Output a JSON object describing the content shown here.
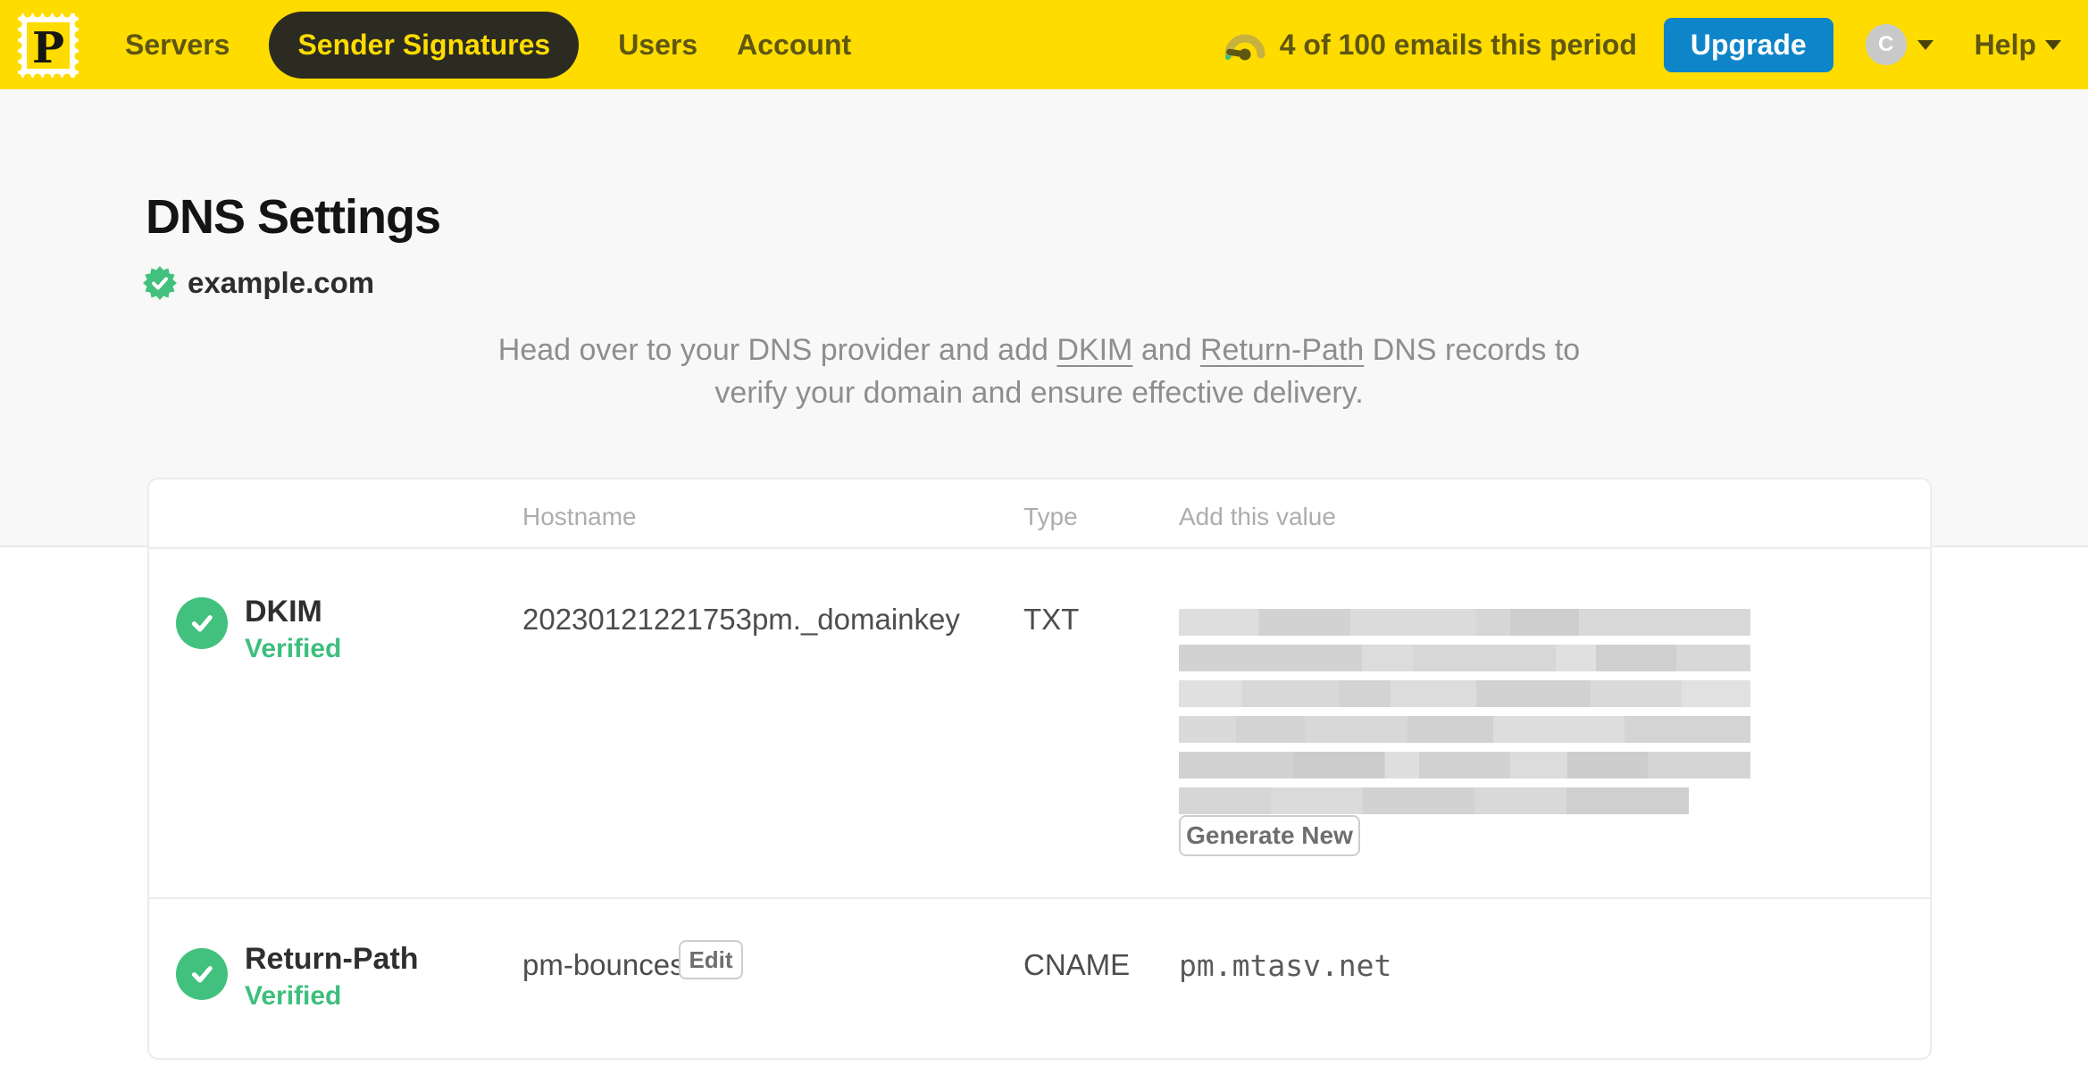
{
  "nav": {
    "logo": "P",
    "items": [
      {
        "label": "Servers",
        "active": false
      },
      {
        "label": "Sender Signatures",
        "active": true
      },
      {
        "label": "Users",
        "active": false
      },
      {
        "label": "Account",
        "active": false
      }
    ],
    "usage": "4 of 100 emails this period",
    "upgrade_label": "Upgrade",
    "avatar_initial": "C",
    "help_label": "Help"
  },
  "page": {
    "title": "DNS Settings",
    "domain": "example.com",
    "domain_status": "verified",
    "instruction": {
      "prefix": "Head over to your DNS provider and add ",
      "link_dkim": "DKIM",
      "and": " and ",
      "link_return_path": "Return-Path",
      "suffix": " DNS records to verify your domain and ensure effective delivery."
    }
  },
  "table": {
    "headers": {
      "hostname": "Hostname",
      "type": "Type",
      "value": "Add this value"
    },
    "rows": [
      {
        "name": "DKIM",
        "status": "Verified",
        "hostname": "20230121221753pm._domainkey",
        "type": "TXT",
        "value": "redacted",
        "action": "Generate New"
      },
      {
        "name": "Return-Path",
        "status": "Verified",
        "hostname": "pm-bounces",
        "edit": "Edit",
        "type": "CNAME",
        "value": "pm.mtasv.net"
      }
    ]
  },
  "colors": {
    "brand_yellow": "#FFDC00",
    "upgrade_blue": "#0E85C9",
    "verified_green": "#41C17D"
  }
}
